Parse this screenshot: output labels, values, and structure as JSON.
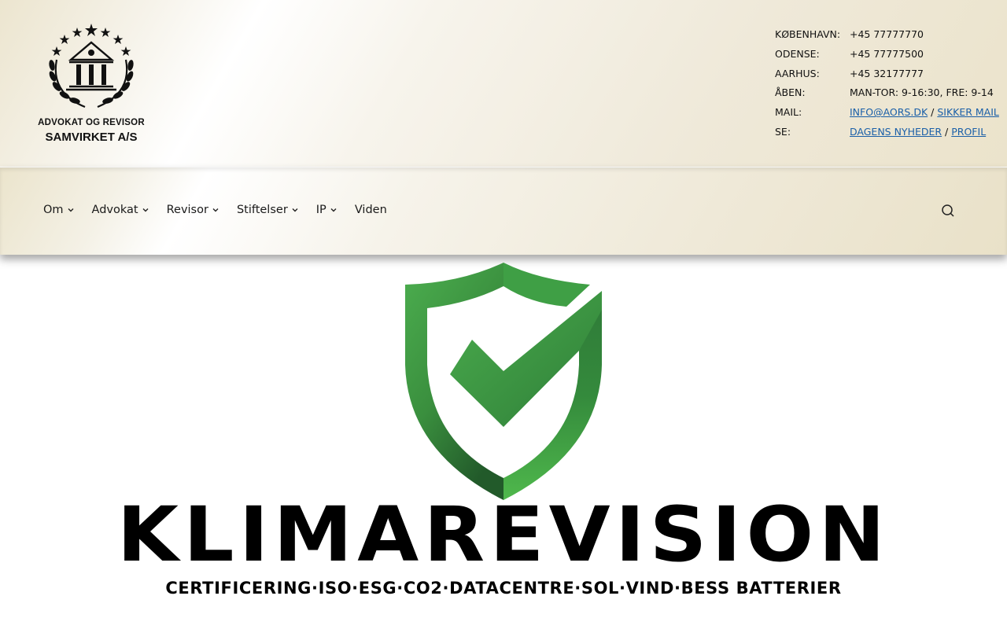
{
  "logo": {
    "line1": "ADVOKAT OG REVISOR",
    "line2": "SAMVIRKET A/S",
    "icon": "courthouse-laurel-stars-emblem"
  },
  "contact": {
    "rows": [
      {
        "label": "KØBENHAVN:",
        "value": "+45 77777770"
      },
      {
        "label": "ODENSE:",
        "value": "+45 77777500"
      },
      {
        "label": "AARHUS:",
        "value": "+45 32177777"
      },
      {
        "label": "ÅBEN:",
        "value": "MAN-TOR: 9-16:30, FRE: 9-14"
      }
    ],
    "mail": {
      "label": "MAIL:",
      "link1": "INFO@AORS.DK",
      "separator": " / ",
      "link2": "SIKKER MAIL"
    },
    "se": {
      "label": "SE:",
      "link1": "DAGENS NYHEDER",
      "separator": " / ",
      "link2": "PROFIL"
    },
    "link_color": "#1a5fa8"
  },
  "nav": {
    "items": [
      {
        "label": "Om",
        "dropdown": true
      },
      {
        "label": "Advokat",
        "dropdown": true
      },
      {
        "label": "Revisor",
        "dropdown": true
      },
      {
        "label": "Stiftelser",
        "dropdown": true
      },
      {
        "label": "IP",
        "dropdown": true
      },
      {
        "label": "Viden",
        "dropdown": false
      }
    ],
    "search_icon": "search-icon"
  },
  "hero": {
    "title": "KLIMAREVISION",
    "subtitle": "CERTIFICERING·ISO·ESG·CO2·DATACENTRE·SOL·VIND·BESS BATTERIER",
    "icon": "shield-check-icon",
    "accent_color": "#3a9a44"
  }
}
